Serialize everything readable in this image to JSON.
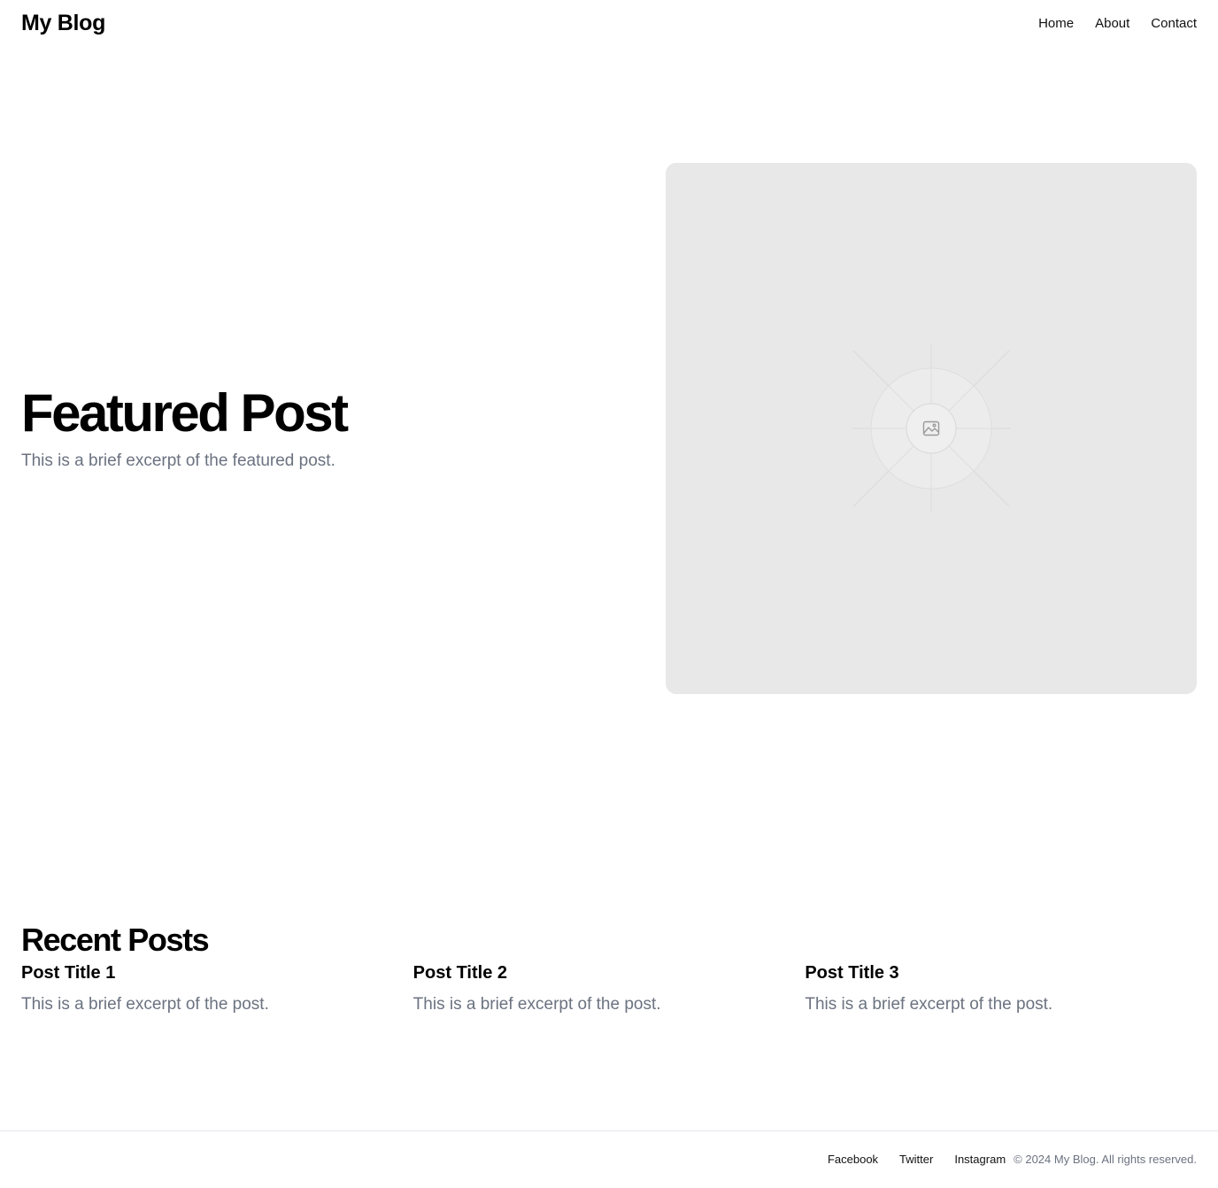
{
  "header": {
    "brand": "My Blog",
    "nav": [
      "Home",
      "About",
      "Contact"
    ]
  },
  "hero": {
    "title": "Featured Post",
    "excerpt": "This is a brief excerpt of the featured post.",
    "image_icon": "image-placeholder-icon"
  },
  "recent": {
    "heading": "Recent Posts",
    "posts": [
      {
        "title": "Post Title 1",
        "excerpt": "This is a brief excerpt of the post."
      },
      {
        "title": "Post Title 2",
        "excerpt": "This is a brief excerpt of the post."
      },
      {
        "title": "Post Title 3",
        "excerpt": "This is a brief excerpt of the post."
      }
    ]
  },
  "footer": {
    "social": [
      "Facebook",
      "Twitter",
      "Instagram"
    ],
    "copyright": "© 2024 My Blog. All rights reserved."
  },
  "colors": {
    "text": "#000000",
    "muted": "#6b7280",
    "placeholder_bg": "#e8e8e8",
    "border": "#e5e7eb"
  }
}
